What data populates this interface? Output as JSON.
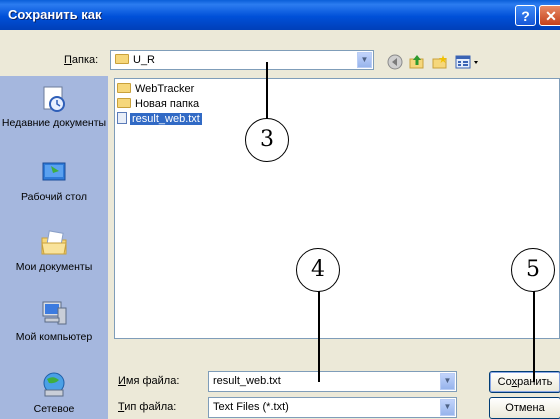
{
  "dialog": {
    "title": "Сохранить как",
    "help_label": "?",
    "close_label": "✕"
  },
  "lookin": {
    "label_prefix": "П",
    "label_rest": "апка:",
    "value": "U_R"
  },
  "toolbar": {
    "icons": [
      "back-icon",
      "up-folder-icon",
      "new-folder-icon",
      "views-menu-icon"
    ]
  },
  "places": [
    {
      "label": "Недавние документы",
      "icon": "recent-documents-icon"
    },
    {
      "label": "Рабочий стол",
      "icon": "desktop-icon"
    },
    {
      "label": "Мои документы",
      "icon": "my-documents-icon"
    },
    {
      "label": "Мой компьютер",
      "icon": "my-computer-icon"
    },
    {
      "label": "Сетевое",
      "icon": "network-icon"
    }
  ],
  "files": [
    {
      "name": "WebTracker",
      "type": "folder"
    },
    {
      "name": "Новая папка",
      "type": "folder"
    },
    {
      "name": "result_web.txt",
      "type": "txt",
      "selected": true
    }
  ],
  "filename": {
    "label_prefix": "И",
    "label_rest": "мя файла:",
    "value": "result_web.txt"
  },
  "filetype": {
    "label_prefix": "Т",
    "label_rest": "ип файла:",
    "value": "Text Files (*.txt)"
  },
  "buttons": {
    "save_prefix": "Со",
    "save_underline": "х",
    "save_rest": "ранить",
    "cancel": "Отмена"
  },
  "callouts": [
    "3",
    "4",
    "5"
  ]
}
